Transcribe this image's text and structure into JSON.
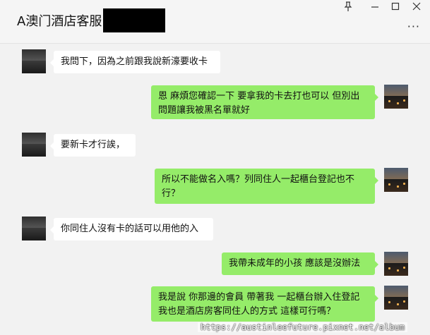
{
  "header": {
    "title": "A澳门酒店客服",
    "pin_icon": "pin-icon",
    "minimize_icon": "minimize-icon",
    "maximize_icon": "maximize-icon",
    "close_icon": "close-icon",
    "more_label": "···"
  },
  "messages": [
    {
      "side": "left",
      "text": "我問下，因為之前跟我說新濠要收卡"
    },
    {
      "side": "right",
      "text": "恩 麻煩您確認一下  要拿我的卡去打也可以  但別出問題讓我被黑名單就好"
    },
    {
      "side": "left",
      "text": "要新卡才行誒，"
    },
    {
      "side": "right",
      "text": "所以不能做名入嗎？列同住人一起櫃台登記也不行？"
    },
    {
      "side": "left",
      "text": "你同住人沒有卡的話可以用他的入"
    },
    {
      "side": "right",
      "text": "我帶未成年的小孩 應該是沒辦法"
    },
    {
      "side": "right",
      "text": "我是說  你那邊的會員 帶著我  一起櫃台辦入住登記  我也是酒店房客同住人的方式  這樣可行嗎？"
    }
  ],
  "watermark": "https://austinleefuture.pixnet.net/album",
  "colors": {
    "bubble_self": "#95ec69",
    "bubble_other": "#ffffff",
    "background": "#f2f2f2"
  }
}
